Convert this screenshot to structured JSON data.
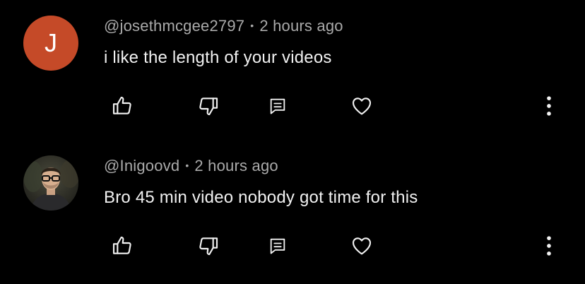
{
  "comments": [
    {
      "avatar": {
        "kind": "letter",
        "letter": "J",
        "color": "#c54a28"
      },
      "author": "@josethmcgee2797",
      "separator": "•",
      "time": "2 hours ago",
      "text": "i like the length of your videos"
    },
    {
      "avatar": {
        "kind": "photo",
        "description_icon": "profile-photo"
      },
      "author": "@Inigoovd",
      "separator": "•",
      "time": "2 hours ago",
      "text": "Bro 45 min video nobody got time for this"
    }
  ],
  "actions": {
    "like_icon": "thumbs-up-icon",
    "dislike_icon": "thumbs-down-icon",
    "reply_icon": "reply-comment-icon",
    "heart_icon": "heart-icon",
    "more_icon": "more-vertical-icon"
  },
  "colors": {
    "background": "#000000",
    "text": "#f1f1f1",
    "meta": "#aaaaaa"
  }
}
